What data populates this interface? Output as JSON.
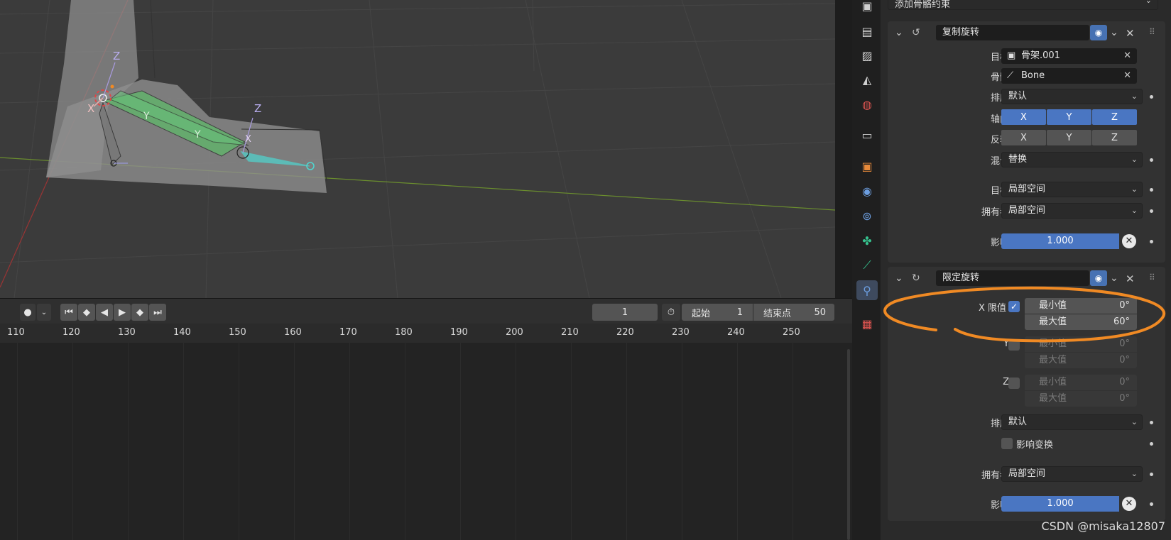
{
  "viewport": {
    "axes": {
      "z1": "Z",
      "x1": "X",
      "y1": "Y",
      "y2": "Y",
      "z2": "Z",
      "x2": "X"
    }
  },
  "timeline": {
    "current_frame": "1",
    "start_label": "起始",
    "start_value": "1",
    "end_label": "结束点",
    "end_value": "50",
    "ruler": [
      "110",
      "120",
      "130",
      "140",
      "150",
      "160",
      "170",
      "180",
      "190",
      "200",
      "210",
      "220",
      "230",
      "240",
      "250"
    ]
  },
  "properties": {
    "add_constraint": "添加骨骼约束",
    "copy_rotation": {
      "name": "复制旋转",
      "target_label": "目标",
      "target_value": "骨架.001",
      "bone_label": "骨骼",
      "bone_value": "Bone",
      "order_label": "排序",
      "order_value": "默认",
      "axis_label": "轴向",
      "axis_x": "X",
      "axis_y": "Y",
      "axis_z": "Z",
      "invert_label": "反转",
      "invert_x": "X",
      "invert_y": "Y",
      "invert_z": "Z",
      "mix_label": "混合",
      "mix_value": "替换",
      "target_space_label": "目标",
      "target_space_value": "局部空间",
      "owner_label": "拥有者",
      "owner_value": "局部空间",
      "influence_label": "影响",
      "influence_value": "1.000"
    },
    "limit_rotation": {
      "name": "限定旋转",
      "x_limit_label": "X 限值",
      "x_min_label": "最小值",
      "x_min_value": "0°",
      "x_max_label": "最大值",
      "x_max_value": "60°",
      "y_label": "Y",
      "y_min_label": "最小值",
      "y_min_value": "0°",
      "y_max_label": "最大值",
      "y_max_value": "0°",
      "z_label": "Z",
      "z_min_label": "最小值",
      "z_min_value": "0°",
      "z_max_label": "最大值",
      "z_max_value": "0°",
      "order_label": "排序",
      "order_value": "默认",
      "affect_transform": "影响变换",
      "owner_label": "拥有者",
      "owner_value": "局部空间",
      "influence_label": "影响",
      "influence_value": "1.000"
    }
  },
  "watermark": "CSDN @misaka12807",
  "colors": {
    "accent": "#4a76c2",
    "annotation": "#f08a24",
    "bone_green": "#5fb86a",
    "bone_cyan": "#4fd6d0"
  }
}
